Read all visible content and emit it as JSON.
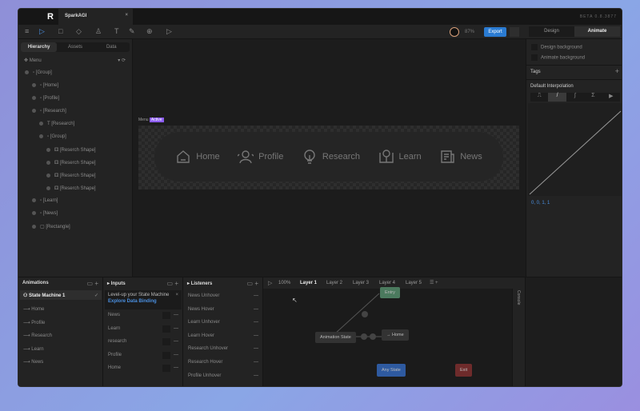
{
  "app": {
    "tab_title": "SparkAGI",
    "version": "BETA 0.8.3877",
    "zoom": "87%",
    "export": "Export",
    "mode_tabs": [
      "Design",
      "Animate"
    ],
    "active_mode": "Animate"
  },
  "left": {
    "tabs": [
      "Hierarchy",
      "Assets",
      "Data"
    ],
    "root": "Menu",
    "tree": [
      {
        "label": "[Group]",
        "depth": 0
      },
      {
        "label": "[Home]",
        "depth": 1
      },
      {
        "label": "[Profile]",
        "depth": 1
      },
      {
        "label": "[Research]",
        "depth": 1
      },
      {
        "label": "[Research]",
        "depth": 2
      },
      {
        "label": "[Group]",
        "depth": 2
      },
      {
        "label": "[Reserch Shape]",
        "depth": 3
      },
      {
        "label": "[Reserch Shape]",
        "depth": 3
      },
      {
        "label": "[Reserch Shape]",
        "depth": 3
      },
      {
        "label": "[Reserch Shape]",
        "depth": 3
      },
      {
        "label": "[Learn]",
        "depth": 1
      },
      {
        "label": "[News]",
        "depth": 1
      },
      {
        "label": "[Rectangle]",
        "depth": 1
      }
    ]
  },
  "canvas": {
    "artboard_label": "Menu",
    "badge": "Active",
    "nav": [
      "Home",
      "Profile",
      "Research",
      "Learn",
      "News"
    ]
  },
  "right": {
    "design_bg": "Design background",
    "animate_bg": "Animate background",
    "tags": "Tags",
    "interp": "Default Interpolation",
    "curve_values": "0, 0, 1, 1"
  },
  "animations": {
    "title": "Animations",
    "state_machine": "State Machine 1",
    "items": [
      "Home",
      "Profile",
      "Research",
      "Learn",
      "News"
    ]
  },
  "inputs": {
    "title": "Inputs",
    "banner": "Level-up your State Machine",
    "banner_link": "Explore Data Binding",
    "items": [
      "News",
      "Learn",
      "research",
      "Profile",
      "Home"
    ]
  },
  "listeners": {
    "title": "Listeners",
    "items": [
      "News Unhover",
      "News Hover",
      "Learn Unhover",
      "Learn Hover",
      "Research Unhover",
      "Research Hover",
      "Profile Unhover"
    ]
  },
  "graph": {
    "zoom": "100%",
    "layers": [
      "Layer 1",
      "Layer 2",
      "Layer 3",
      "Layer 4",
      "Layer 5"
    ],
    "nodes": {
      "entry": "Entry",
      "anim": "Animation State",
      "home": "→ Home",
      "any": "Any State",
      "exit": "Exit"
    },
    "console": "Console"
  }
}
